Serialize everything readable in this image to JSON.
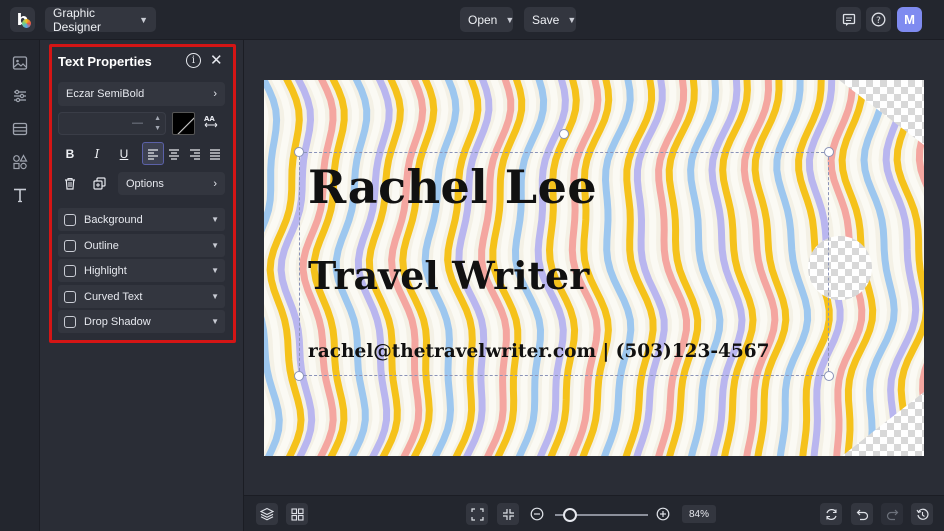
{
  "app": {
    "mode_label": "Graphic Designer"
  },
  "topbar": {
    "open_label": "Open",
    "save_label": "Save",
    "avatar_initial": "M"
  },
  "panel": {
    "title": "Text Properties",
    "font_name": "Eczar SemiBold",
    "font_size_value": "—",
    "text_color": "#000000",
    "format_buttons": [
      "B",
      "I",
      "U"
    ],
    "options_label": "Options",
    "effects": [
      {
        "label": "Background",
        "checked": false
      },
      {
        "label": "Outline",
        "checked": false
      },
      {
        "label": "Highlight",
        "checked": false
      },
      {
        "label": "Curved Text",
        "checked": false
      },
      {
        "label": "Drop Shadow",
        "checked": false
      }
    ]
  },
  "canvas": {
    "name_text": "Rachel Lee",
    "title_text": "Travel Writer",
    "contact_text": "rachel@thetravelwriter.com | (503)123-4567",
    "stripe_colors": [
      "#f5c21b",
      "#9dc7ef",
      "#f4a6a0",
      "#b9b6ef",
      "#fbfaf4"
    ]
  },
  "bottombar": {
    "zoom_value": "84%"
  },
  "colors": {
    "highlight_box": "#d41515",
    "accent": "#7f8bf0"
  }
}
